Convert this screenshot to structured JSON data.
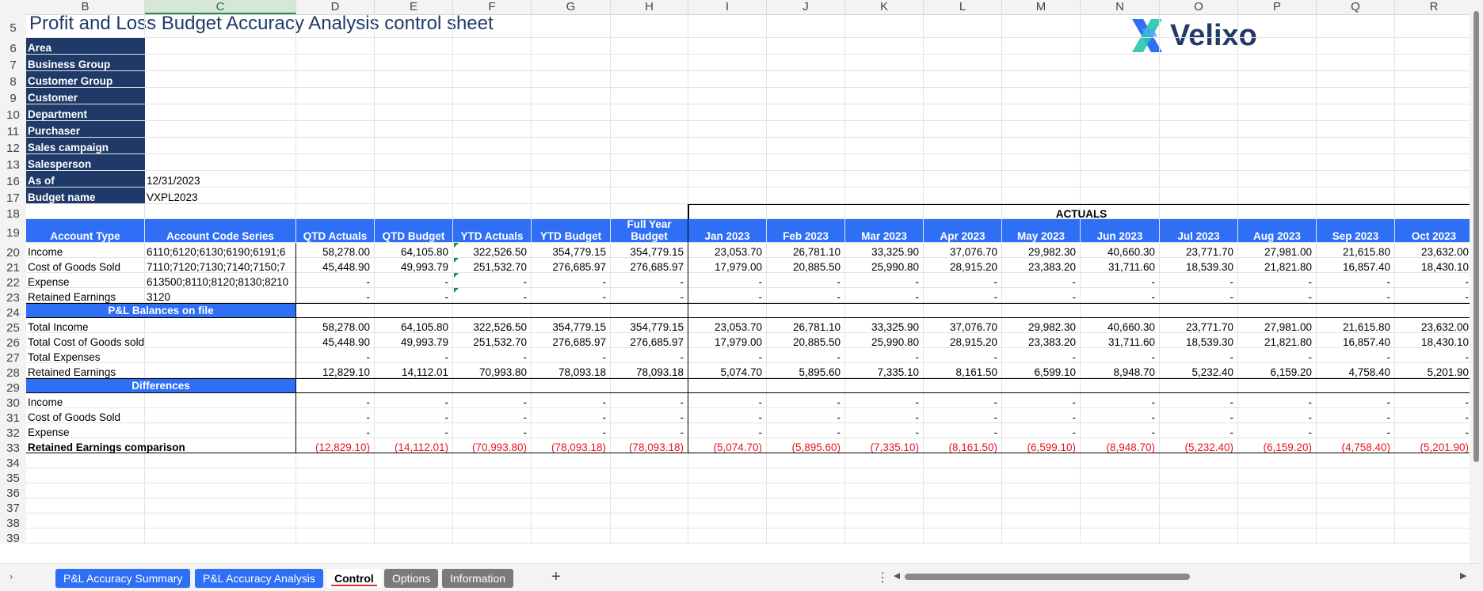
{
  "title": "Profit and Loss Budget Accuracy Analysis control sheet",
  "logo_text": "Velixo",
  "column_letters": [
    "B",
    "C",
    "D",
    "E",
    "F",
    "G",
    "H",
    "I",
    "J",
    "K",
    "L",
    "M",
    "N",
    "O",
    "P",
    "Q",
    "R"
  ],
  "row_numbers": [
    "5",
    "6",
    "7",
    "8",
    "9",
    "10",
    "11",
    "12",
    "13",
    "16",
    "17",
    "18",
    "19",
    "20",
    "21",
    "22",
    "23",
    "24",
    "25",
    "26",
    "27",
    "28",
    "29",
    "30",
    "31",
    "32",
    "33",
    "34",
    "35",
    "36",
    "37",
    "38",
    "39"
  ],
  "filters": [
    "Area",
    "Business Group",
    "Customer Group",
    "Customer",
    "Department",
    "Purchaser",
    "Sales campaign",
    "Salesperson"
  ],
  "as_of_label": "As of",
  "as_of_value": "12/31/2023",
  "budget_name_label": "Budget name",
  "budget_name_value": "VXPL2023",
  "actuals_label": "ACTUALS",
  "headers": [
    "Account Type",
    "Account Code Series",
    "QTD Actuals",
    "QTD Budget",
    "YTD Actuals",
    "YTD Budget",
    "Full Year Budget",
    "Jan 2023",
    "Feb 2023",
    "Mar 2023",
    "Apr 2023",
    "May 2023",
    "Jun 2023",
    "Jul 2023",
    "Aug 2023",
    "Sep 2023",
    "Oct 2023"
  ],
  "accounts": [
    {
      "type": "Income",
      "codes": "6110;6120;6130;6190;6191;6",
      "values": [
        "58,278.00",
        "64,105.80",
        "322,526.50",
        "354,779.15",
        "354,779.15",
        "23,053.70",
        "26,781.10",
        "33,325.90",
        "37,076.70",
        "29,982.30",
        "40,660.30",
        "23,771.70",
        "27,981.00",
        "21,615.80",
        "23,632.00"
      ]
    },
    {
      "type": "Cost of Goods Sold",
      "codes": "7110;7120;7130;7140;7150;7",
      "values": [
        "45,448.90",
        "49,993.79",
        "251,532.70",
        "276,685.97",
        "276,685.97",
        "17,979.00",
        "20,885.50",
        "25,990.80",
        "28,915.20",
        "23,383.20",
        "31,711.60",
        "18,539.30",
        "21,821.80",
        "16,857.40",
        "18,430.10"
      ]
    },
    {
      "type": "Expense",
      "codes": "613500;8110;8120;8130;8210",
      "values": [
        "-",
        "-",
        "-",
        "-",
        "-",
        "-",
        "-",
        "-",
        "-",
        "-",
        "-",
        "-",
        "-",
        "-",
        "-"
      ]
    },
    {
      "type": "Retained Earnings",
      "codes": "3120",
      "values": [
        "-",
        "-",
        "-",
        "-",
        "-",
        "-",
        "-",
        "-",
        "-",
        "-",
        "-",
        "-",
        "-",
        "-",
        "-"
      ]
    }
  ],
  "balances_header": "P&L Balances on file",
  "balances": [
    {
      "label": "Total Income",
      "values": [
        "58,278.00",
        "64,105.80",
        "322,526.50",
        "354,779.15",
        "354,779.15",
        "23,053.70",
        "26,781.10",
        "33,325.90",
        "37,076.70",
        "29,982.30",
        "40,660.30",
        "23,771.70",
        "27,981.00",
        "21,615.80",
        "23,632.00"
      ]
    },
    {
      "label": "Total Cost of Goods sold",
      "values": [
        "45,448.90",
        "49,993.79",
        "251,532.70",
        "276,685.97",
        "276,685.97",
        "17,979.00",
        "20,885.50",
        "25,990.80",
        "28,915.20",
        "23,383.20",
        "31,711.60",
        "18,539.30",
        "21,821.80",
        "16,857.40",
        "18,430.10"
      ]
    },
    {
      "label": "Total Expenses",
      "values": [
        "-",
        "-",
        "-",
        "-",
        "-",
        "-",
        "-",
        "-",
        "-",
        "-",
        "-",
        "-",
        "-",
        "-",
        "-"
      ]
    },
    {
      "label": "Retained Earnings",
      "values": [
        "12,829.10",
        "14,112.01",
        "70,993.80",
        "78,093.18",
        "78,093.18",
        "5,074.70",
        "5,895.60",
        "7,335.10",
        "8,161.50",
        "6,599.10",
        "8,948.70",
        "5,232.40",
        "6,159.20",
        "4,758.40",
        "5,201.90"
      ]
    }
  ],
  "differences_header": "Differences",
  "differences": [
    {
      "label": "Income",
      "values": [
        "-",
        "-",
        "-",
        "-",
        "-",
        "-",
        "-",
        "-",
        "-",
        "-",
        "-",
        "-",
        "-",
        "-",
        "-"
      ]
    },
    {
      "label": "Cost of Goods Sold",
      "values": [
        "-",
        "-",
        "-",
        "-",
        "-",
        "-",
        "-",
        "-",
        "-",
        "-",
        "-",
        "-",
        "-",
        "-",
        "-"
      ]
    },
    {
      "label": "Expense",
      "values": [
        "-",
        "-",
        "-",
        "-",
        "-",
        "-",
        "-",
        "-",
        "-",
        "-",
        "-",
        "-",
        "-",
        "-",
        "-"
      ]
    },
    {
      "label": "Retained Earnings comparison",
      "values": [
        "(12,829.10)",
        "(14,112.01)",
        "(70,993.80)",
        "(78,093.18)",
        "(78,093.18)",
        "(5,074.70)",
        "(5,895.60)",
        "(7,335.10)",
        "(8,161.50)",
        "(6,599.10)",
        "(8,948.70)",
        "(5,232.40)",
        "(6,159.20)",
        "(4,758.40)",
        "(5,201.90)"
      ]
    }
  ],
  "tabs": [
    {
      "label": "P&L Accuracy Summary",
      "style": "blue"
    },
    {
      "label": "P&L Accuracy Analysis",
      "style": "blue"
    },
    {
      "label": "Control",
      "style": "active"
    },
    {
      "label": "Options",
      "style": "gray"
    },
    {
      "label": "Information",
      "style": "gray"
    }
  ],
  "add_sheet_symbol": "+",
  "colors": {
    "navy": "#1f3a68",
    "blue_header": "#2f6ff5",
    "negative": "#e8141e"
  }
}
